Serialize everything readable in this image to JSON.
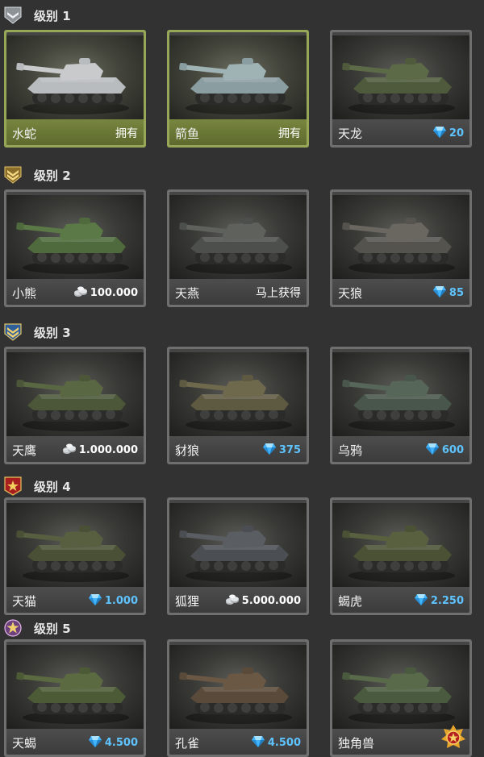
{
  "tiers": [
    {
      "label": "级别 1",
      "badge": "silver-chevron-icon",
      "cards": [
        {
          "name": "水蛇",
          "price": "拥有",
          "price_type": "owned",
          "style": "owned",
          "hull_color": "#b9bcbe",
          "turret_color": "#c8cacc"
        },
        {
          "name": "箭鱼",
          "price": "拥有",
          "price_type": "owned",
          "style": "owned",
          "hull_color": "#8a9da0",
          "turret_color": "#9fb2b4"
        },
        {
          "name": "天龙",
          "price": "20",
          "price_type": "gem",
          "style": "normal",
          "hull_color": "#4f5a3c",
          "turret_color": "#5d6a47"
        }
      ]
    },
    {
      "label": "级别 2",
      "badge": "gold-chevron-icon",
      "cards": [
        {
          "name": "小熊",
          "price": "100.000",
          "price_type": "silver",
          "style": "normal",
          "hull_color": "#4f6a3c",
          "turret_color": "#5b7946"
        },
        {
          "name": "天燕",
          "price": "马上获得",
          "price_type": "soon",
          "style": "normal",
          "hull_color": "#4c4f4b",
          "turret_color": "#5f625c"
        },
        {
          "name": "天狼",
          "price": "85",
          "price_type": "gem",
          "style": "normal",
          "hull_color": "#55534e",
          "turret_color": "#6a6761"
        }
      ]
    },
    {
      "label": "级别 3",
      "badge": "blue-double-chevron-icon",
      "cards": [
        {
          "name": "天鹰",
          "price": "1.000.000",
          "price_type": "silver",
          "style": "normal",
          "hull_color": "#4c573a",
          "turret_color": "#5a6743"
        },
        {
          "name": "豺狼",
          "price": "375",
          "price_type": "gem",
          "style": "normal",
          "hull_color": "#5e5941",
          "turret_color": "#6e684c"
        },
        {
          "name": "乌鸦",
          "price": "600",
          "price_type": "gem",
          "style": "normal",
          "hull_color": "#48564b",
          "turret_color": "#566658"
        }
      ]
    },
    {
      "label": "级别 4",
      "badge": "red-star-icon",
      "cards": [
        {
          "name": "天猫",
          "price": "1.000",
          "price_type": "gem",
          "style": "normal",
          "hull_color": "#4a5036",
          "turret_color": "#575f40"
        },
        {
          "name": "狐狸",
          "price": "5.000.000",
          "price_type": "silver",
          "style": "normal",
          "hull_color": "#4b4e52",
          "turret_color": "#5a5e63"
        },
        {
          "name": "蝎虎",
          "price": "2.250",
          "price_type": "gem",
          "style": "normal",
          "hull_color": "#4a5135",
          "turret_color": "#58603f"
        }
      ]
    },
    {
      "label": "级别 5",
      "badge": "purple-star-icon",
      "cards": [
        {
          "name": "天蝎",
          "price": "4.500",
          "price_type": "gem",
          "style": "normal",
          "hull_color": "#4d5a36",
          "turret_color": "#5b6a40"
        },
        {
          "name": "孔雀",
          "price": "4.500",
          "price_type": "gem",
          "style": "normal",
          "hull_color": "#5a4a3a",
          "turret_color": "#6a5744"
        },
        {
          "name": "独角兽",
          "price": "",
          "price_type": "medal",
          "style": "normal",
          "hull_color": "#4a5a3e",
          "turret_color": "#586a49"
        }
      ]
    }
  ],
  "colors": {
    "owned_frame": "#96a758",
    "gem_price": "#5ec3ff",
    "background": "#323233"
  }
}
